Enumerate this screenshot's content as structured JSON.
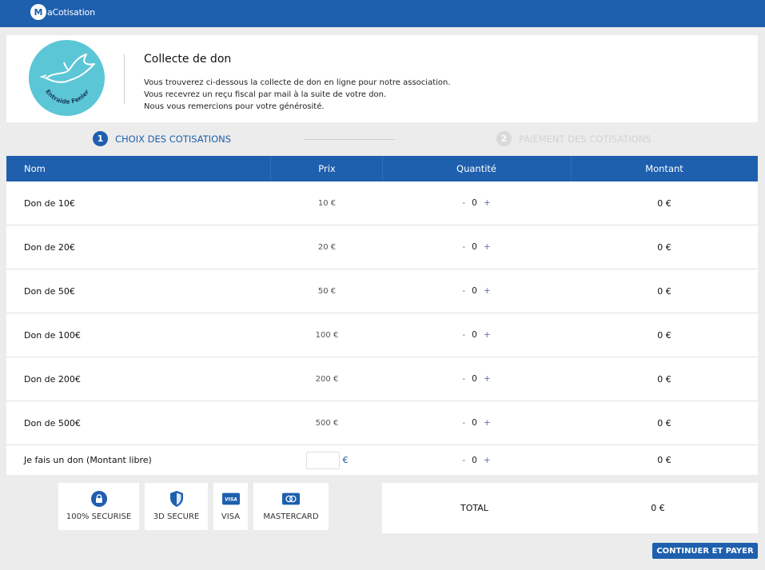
{
  "app": {
    "logo_letter": "M",
    "logo_text": "aCotisation"
  },
  "header": {
    "org_logo_text": "Entraide Fenier",
    "title": "Collecte de don",
    "lines": [
      "Vous trouverez ci-dessous la collecte de don en ligne pour notre association.",
      "Vous recevrez un reçu fiscal par mail à la suite de votre don.",
      "Nous vous remercions pour votre générosité."
    ]
  },
  "steps": [
    {
      "num": "1",
      "label": "CHOIX DES COTISATIONS",
      "active": true
    },
    {
      "num": "2",
      "label": "PAIEMENT DES COTISATIONS",
      "active": false
    }
  ],
  "table": {
    "headers": [
      "Nom",
      "Prix",
      "Quantité",
      "Montant"
    ],
    "rows": [
      {
        "name": "Don de 10€",
        "price": "10 €",
        "qty": "0",
        "amount": "0 €"
      },
      {
        "name": "Don de 20€",
        "price": "20 €",
        "qty": "0",
        "amount": "0 €"
      },
      {
        "name": "Don de 50€",
        "price": "50 €",
        "qty": "0",
        "amount": "0 €"
      },
      {
        "name": "Don de 100€",
        "price": "100 €",
        "qty": "0",
        "amount": "0 €"
      },
      {
        "name": "Don de 200€",
        "price": "200 €",
        "qty": "0",
        "amount": "0 €"
      },
      {
        "name": "Don de 500€",
        "price": "500 €",
        "qty": "0",
        "amount": "0 €"
      }
    ],
    "free_row": {
      "name": "Je fais un don (Montant libre)",
      "input_value": "",
      "currency": "€",
      "qty": "0",
      "amount": "0 €"
    },
    "qty_minus": "-",
    "qty_plus": "+"
  },
  "badges": [
    {
      "label": "100% SECURISE",
      "icon": "lock-icon"
    },
    {
      "label": "3D SECURE",
      "icon": "shield-icon"
    },
    {
      "label": "VISA",
      "icon": "visa-icon",
      "icon_text": "VISA"
    },
    {
      "label": "MASTERCARD",
      "icon": "mastercard-icon"
    }
  ],
  "total": {
    "label": "TOTAL",
    "value": "0 €"
  },
  "actions": {
    "pay_label": "CONTINUER ET PAYER"
  },
  "colors": {
    "primary": "#1e5fae",
    "logo_bg": "#5bc6d6",
    "page_bg": "#ececec"
  }
}
